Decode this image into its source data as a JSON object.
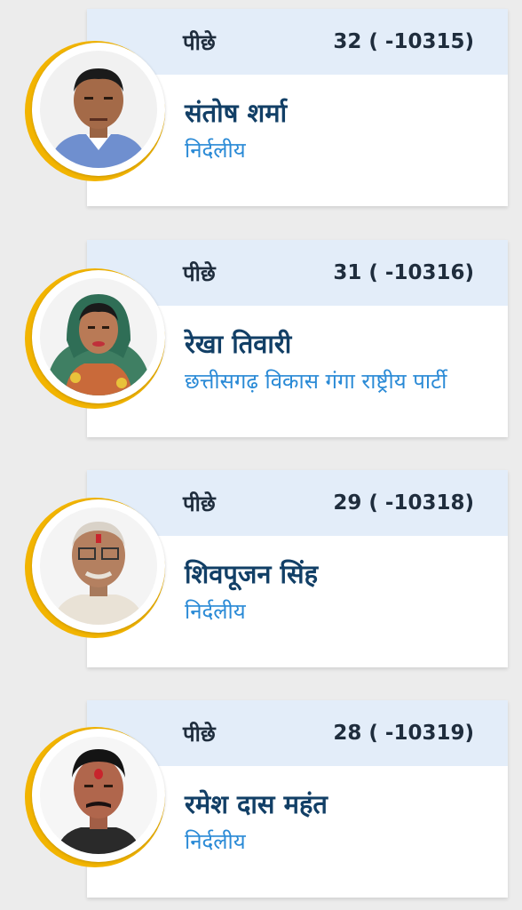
{
  "candidates": [
    {
      "status": "पीछे",
      "rank_margin": "32 ( -10315)",
      "name": "संतोष शर्मा",
      "party": "निर्दलीय",
      "avatar_icon": "person-photo"
    },
    {
      "status": "पीछे",
      "rank_margin": "31 ( -10316)",
      "name": "रेखा तिवारी",
      "party": "छत्तीसगढ़ विकास गंगा राष्ट्रीय पार्टी",
      "avatar_icon": "person-photo"
    },
    {
      "status": "पीछे",
      "rank_margin": "29 ( -10318)",
      "name": "शिवपूजन सिंह",
      "party": "निर्दलीय",
      "avatar_icon": "person-photo"
    },
    {
      "status": "पीछे",
      "rank_margin": "28 ( -10319)",
      "name": "रमेश दास महंत",
      "party": "निर्दलीय",
      "avatar_icon": "person-photo"
    }
  ],
  "colors": {
    "header_bg": "#e3edf9",
    "name": "#123f66",
    "party": "#2a8ad6",
    "ring": "#f2b400"
  }
}
